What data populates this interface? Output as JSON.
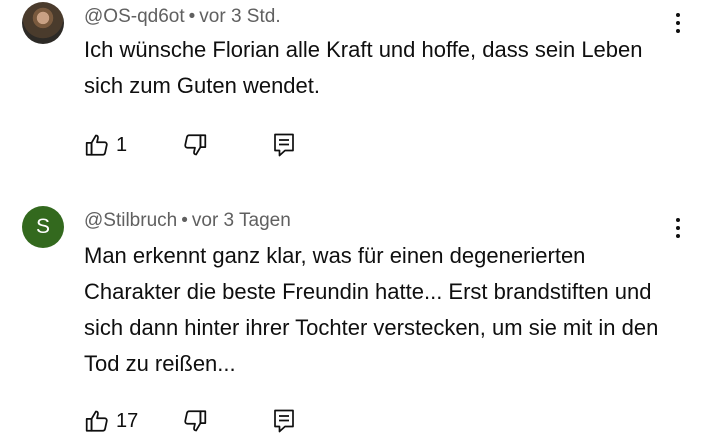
{
  "comments": [
    {
      "author": "@OS-qd6ot",
      "separator": "•",
      "time": "vor 3 Std.",
      "text": "Ich wünsche Florian alle Kraft und hoffe, dass sein Leben sich zum Guten wendet.",
      "likes": "1",
      "avatar": {
        "type": "photo"
      },
      "icons": {
        "like": "thumbs-up-icon",
        "dislike": "thumbs-down-icon",
        "reply": "reply-icon",
        "menu": "more-vert-icon"
      }
    },
    {
      "author": "@Stilbruch",
      "separator": "•",
      "time": "vor 3 Tagen",
      "text": "Man erkennt ganz klar, was für einen degenerierten Charakter die beste Freundin hatte... Erst brandstiften und sich dann hinter ihrer Tochter verstecken, um sie mit in den Tod zu reißen...",
      "likes": "17",
      "avatar": {
        "type": "letter",
        "letter": "S",
        "color": "#33691e"
      },
      "icons": {
        "like": "thumbs-up-icon",
        "dislike": "thumbs-down-icon",
        "reply": "reply-icon",
        "menu": "more-vert-icon"
      }
    }
  ]
}
